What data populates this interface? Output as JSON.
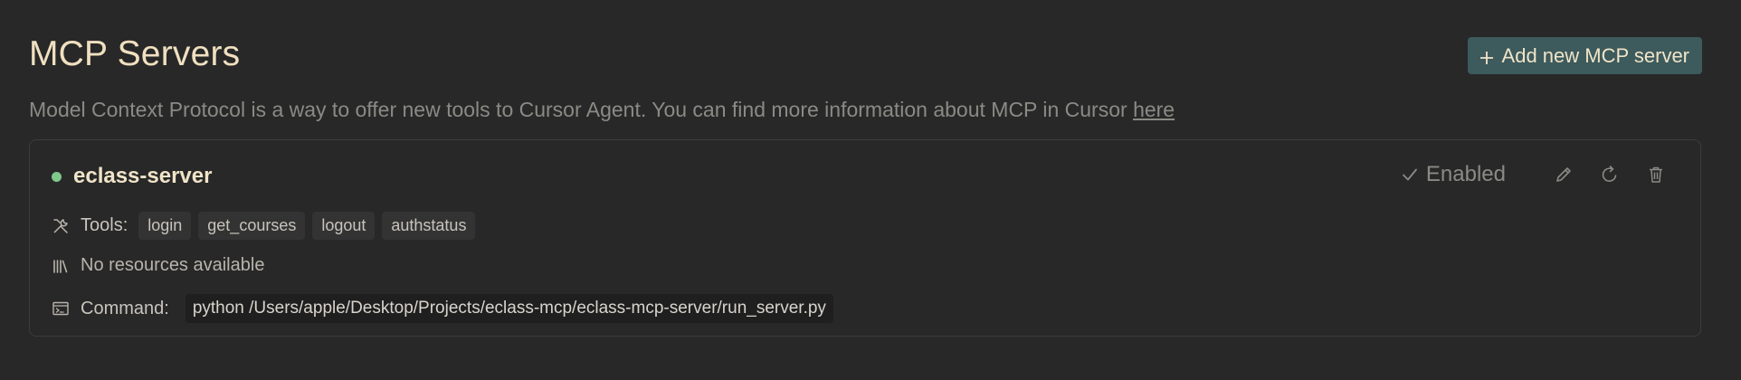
{
  "header": {
    "title": "MCP Servers",
    "add_button_label": "Add new MCP server",
    "description": "Model Context Protocol is a way to offer new tools to Cursor Agent. You can find more information about MCP in Cursor ",
    "description_link": "here"
  },
  "server": {
    "name": "eclass-server",
    "status_color": "#7fc98a",
    "enabled_label": "Enabled",
    "tools_label": "Tools:",
    "tools": [
      "login",
      "get_courses",
      "logout",
      "authstatus"
    ],
    "resources_text": "No resources available",
    "command_label": "Command:",
    "command": "python /Users/apple/Desktop/Projects/eclass-mcp/eclass-mcp-server/run_server.py"
  },
  "colors": {
    "background": "#282828",
    "accent_button": "#3d5a5c",
    "title_text": "#f0e0c0"
  },
  "icons": {
    "add": "plus-icon",
    "enabled": "checkmark-icon",
    "edit": "pencil-icon",
    "refresh": "refresh-icon",
    "delete": "trash-icon",
    "tools": "tools-icon",
    "resources": "library-icon",
    "command": "terminal-icon"
  }
}
